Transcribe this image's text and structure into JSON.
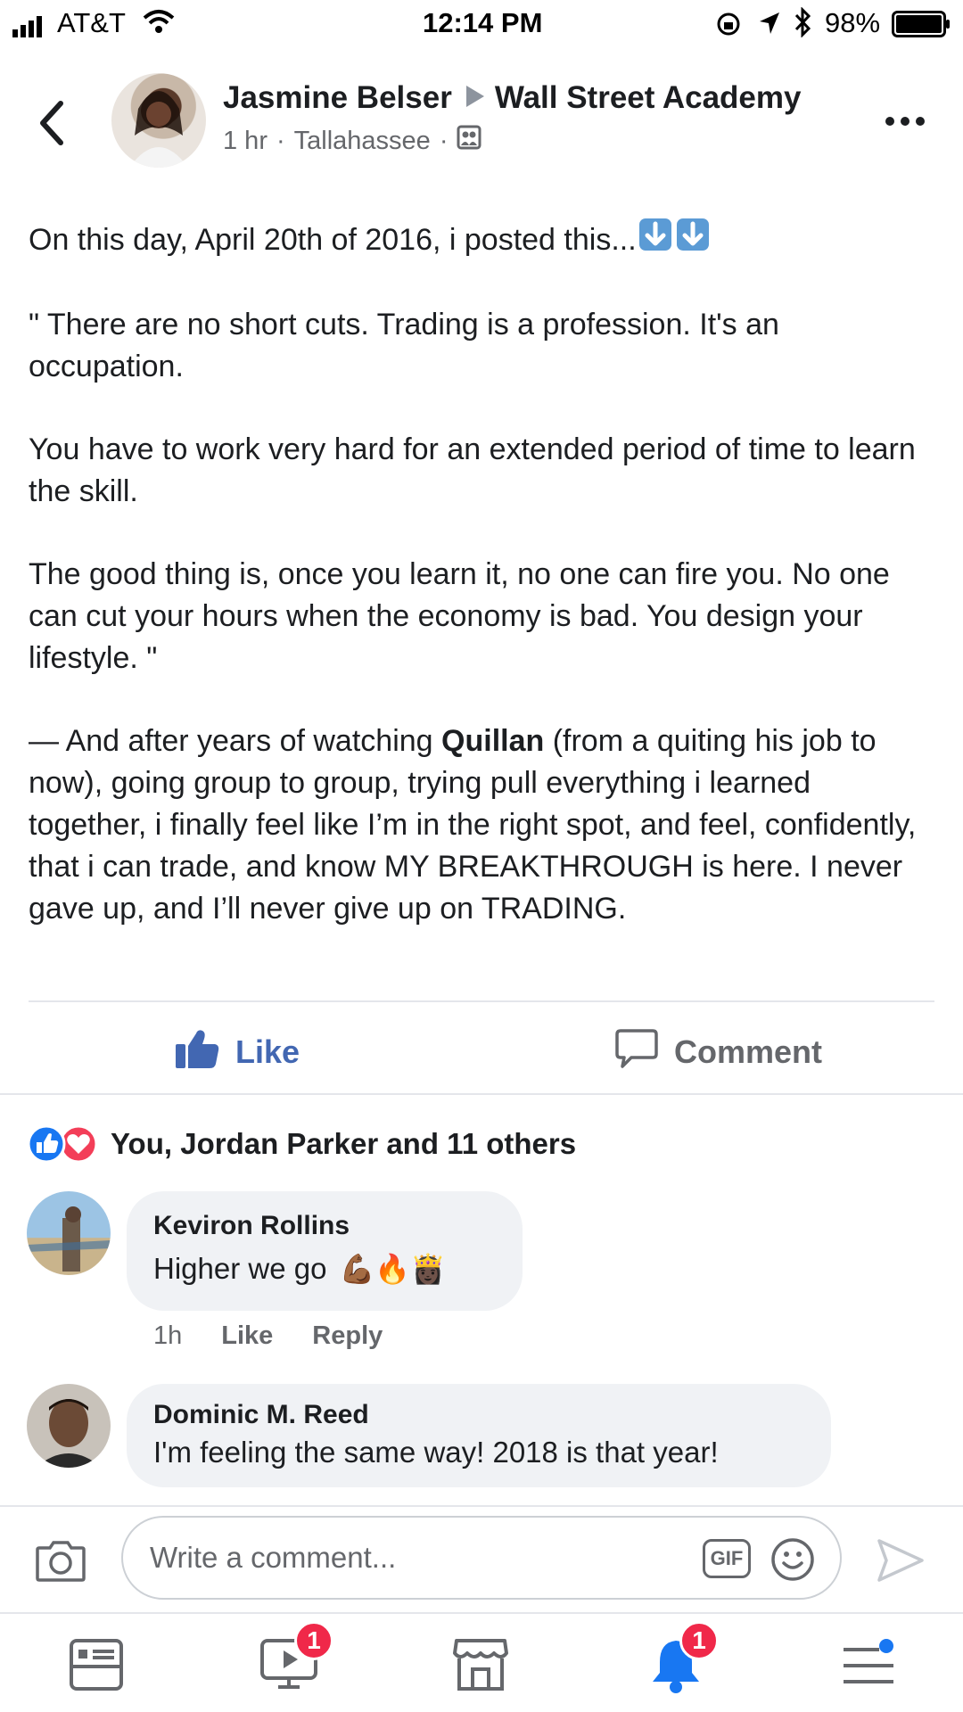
{
  "status": {
    "carrier": "AT&T",
    "time": "12:14 PM",
    "battery": "98%"
  },
  "post": {
    "author": "Jasmine Belser",
    "group": "Wall Street Academy",
    "meta_time": "1 hr",
    "meta_location": "Tallahassee",
    "intro": "On this day, April 20th of 2016, i posted this...",
    "p1": "\" There are no short cuts. Trading is a profession. It's an occupation.",
    "p2": "You have to work very hard for an extended period of time to learn the skill.",
    "p3": "The good thing is, once you learn it, no one can fire you. No one can cut your hours when the economy is bad. You design your lifestyle. \"",
    "p4_a": "— And after years of watching ",
    "p4_bold": "Quillan",
    "p4_b": " (from a quiting his job to now), going group to group, trying pull everything i learned together, i finally feel like I’m in the right spot, and feel, confidently, that i can trade, and know MY BREAKTHROUGH is here. I never gave up, and I’ll never give up on TRADING."
  },
  "actions": {
    "like": "Like",
    "comment": "Comment"
  },
  "reactions": {
    "summary": "You, Jordan Parker and 11 others"
  },
  "comments": [
    {
      "name": "Keviron Rollins",
      "text": "Higher we go",
      "emojis": "💪🏾🔥👸🏿",
      "time": "1h",
      "like": "Like",
      "reply": "Reply"
    },
    {
      "name": "Dominic M. Reed",
      "text": "I'm feeling the same way! 2018 is that year!"
    }
  ],
  "composer": {
    "placeholder": "Write a comment...",
    "gif": "GIF"
  },
  "nav": {
    "watch_badge": "1",
    "notif_badge": "1"
  },
  "colors": {
    "accent": "#4267b2",
    "like_blue": "#1877f2",
    "love_red": "#f33e58",
    "badge": "#f02849"
  }
}
